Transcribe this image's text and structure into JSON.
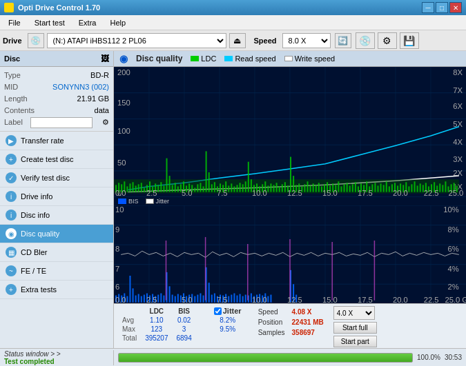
{
  "app": {
    "title": "Opti Drive Control 1.70",
    "icon": "disc-icon"
  },
  "titlebar": {
    "minimize": "─",
    "maximize": "□",
    "close": "✕"
  },
  "menu": {
    "items": [
      "File",
      "Start test",
      "Extra",
      "Help"
    ]
  },
  "drive": {
    "label": "Drive",
    "select_value": "(N:)  ATAPI iHBS112  2 PL06",
    "speed_label": "Speed",
    "speed_value": "8.0 X"
  },
  "disc": {
    "header": "Disc",
    "type_label": "Type",
    "type_value": "BD-R",
    "mid_label": "MID",
    "mid_value": "SONYNN3 (002)",
    "length_label": "Length",
    "length_value": "21.91 GB",
    "contents_label": "Contents",
    "contents_value": "data",
    "label_label": "Label",
    "label_value": ""
  },
  "nav": {
    "items": [
      {
        "id": "transfer-rate",
        "label": "Transfer rate",
        "icon": "▶"
      },
      {
        "id": "create-test-disc",
        "label": "Create test disc",
        "icon": "+"
      },
      {
        "id": "verify-test-disc",
        "label": "Verify test disc",
        "icon": "✓"
      },
      {
        "id": "drive-info",
        "label": "Drive info",
        "icon": "i"
      },
      {
        "id": "disc-info",
        "label": "Disc info",
        "icon": "i"
      },
      {
        "id": "disc-quality",
        "label": "Disc quality",
        "icon": "◉",
        "active": true
      },
      {
        "id": "cd-bler",
        "label": "CD Bler",
        "icon": "▦"
      },
      {
        "id": "fe-te",
        "label": "FE / TE",
        "icon": "~"
      },
      {
        "id": "extra-tests",
        "label": "Extra tests",
        "icon": "+"
      }
    ]
  },
  "chart": {
    "title": "Disc quality",
    "legends": [
      {
        "id": "ldc",
        "label": "LDC",
        "color": "#00cc00"
      },
      {
        "id": "read-speed",
        "label": "Read speed",
        "color": "#00ccff"
      },
      {
        "id": "write-speed",
        "label": "Write speed",
        "color": "#ffffff"
      },
      {
        "id": "bis",
        "label": "BIS",
        "color": "#0055ff"
      },
      {
        "id": "jitter",
        "label": "Jitter",
        "color": "#ffffff"
      }
    ]
  },
  "stats": {
    "columns": [
      "LDC",
      "BIS",
      "",
      "Jitter",
      "Speed",
      ""
    ],
    "rows": [
      {
        "label": "Avg",
        "ldc": "1.10",
        "bis": "0.02",
        "jitter_check": true,
        "jitter": "8.2%",
        "speed_label": "Speed",
        "speed_val": "4.08 X"
      },
      {
        "label": "Max",
        "ldc": "123",
        "bis": "3",
        "jitter": "9.5%",
        "speed_label": "Position",
        "speed_val": "22431 MB"
      },
      {
        "label": "Total",
        "ldc": "395207",
        "bis": "6894",
        "speed_label": "Samples",
        "speed_val": "358697"
      }
    ],
    "speed_select": "4.0 X",
    "btn_full": "Start full",
    "btn_part": "Start part"
  },
  "statusbar": {
    "status_window": "Status window > >",
    "test_completed": "Test completed",
    "progress": 100,
    "progress_text": "100.0%",
    "time": "30:53"
  }
}
